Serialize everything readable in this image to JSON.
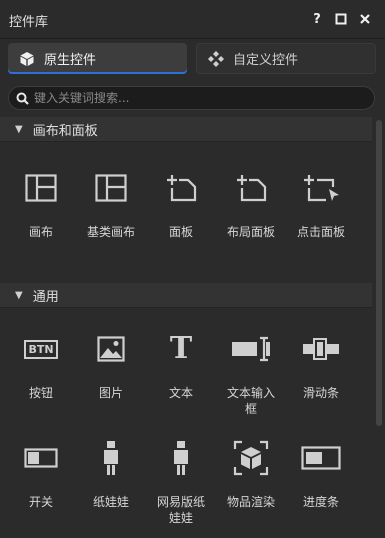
{
  "window": {
    "title": "控件库",
    "help_label": "?"
  },
  "tabs": [
    {
      "label": "原生控件",
      "icon": "cube-icon",
      "active": true
    },
    {
      "label": "自定义控件",
      "icon": "diamond-grid-icon",
      "active": false
    }
  ],
  "search": {
    "placeholder": "键入关键词搜索...",
    "value": ""
  },
  "sections": [
    {
      "title": "画布和面板",
      "expanded": true,
      "items": [
        {
          "label": "画布",
          "icon": "canvas-icon"
        },
        {
          "label": "基类画布",
          "icon": "base-canvas-icon"
        },
        {
          "label": "面板",
          "icon": "panel-icon"
        },
        {
          "label": "布局面板",
          "icon": "layout-panel-icon"
        },
        {
          "label": "点击面板",
          "icon": "click-panel-icon"
        }
      ]
    },
    {
      "title": "通用",
      "expanded": true,
      "items": [
        {
          "label": "按钮",
          "icon": "button-icon"
        },
        {
          "label": "图片",
          "icon": "image-icon"
        },
        {
          "label": "文本",
          "icon": "text-icon"
        },
        {
          "label": "文本输入框",
          "icon": "text-input-icon"
        },
        {
          "label": "滑动条",
          "icon": "slider-icon"
        },
        {
          "label": "开关",
          "icon": "toggle-icon"
        },
        {
          "label": "纸娃娃",
          "icon": "paperdoll-icon"
        },
        {
          "label": "网易版纸娃娃",
          "icon": "netease-paperdoll-icon"
        },
        {
          "label": "物品渲染",
          "icon": "item-render-icon"
        },
        {
          "label": "进度条",
          "icon": "progress-bar-icon"
        }
      ]
    }
  ],
  "icon_glyphs": {
    "button_text": "BTN",
    "text_glyph": "T"
  },
  "colors": {
    "background": "#2b2b2b",
    "accent": "#2e6fd8",
    "icon": "#d0d0d0"
  }
}
